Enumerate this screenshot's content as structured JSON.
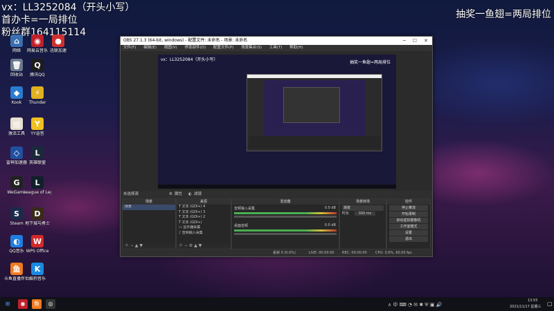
{
  "overlay": {
    "line1": "vx：LL3252084（开头小写）",
    "line2": "首办卡=一局排位",
    "line3": "粉丝群164115114",
    "right": "抽奖一鱼翅=两局排位"
  },
  "desktop_icons": [
    {
      "label": "网络",
      "color": "#3a6fb0",
      "glyph": "⌂"
    },
    {
      "label": "网易云音乐",
      "color": "#c0202a",
      "glyph": "◉"
    },
    {
      "label": "迅联加速",
      "color": "#d13030",
      "glyph": "●"
    },
    {
      "label": "回收站",
      "color": "#6a7a8a",
      "glyph": "🗑"
    },
    {
      "label": "腾讯QQ",
      "color": "#1d1d1d",
      "glyph": "Q"
    },
    {
      "label": "Kook",
      "color": "#2a7bd0",
      "glyph": "◆"
    },
    {
      "label": "Thunder",
      "color": "#e0b020",
      "glyph": "⚡"
    },
    {
      "label": "激活工具",
      "color": "#e8e0d0",
      "glyph": "▤"
    },
    {
      "label": "YY语音",
      "color": "#f0c020",
      "glyph": "Y"
    },
    {
      "label": "雷神加速器",
      "color": "#2050a0",
      "glyph": "◇"
    },
    {
      "label": "英雄联盟",
      "color": "#1a2a3a",
      "glyph": "L"
    },
    {
      "label": "WeGame",
      "color": "#222222",
      "glyph": "G"
    },
    {
      "label": "League of Legends",
      "color": "#10202a",
      "glyph": "L"
    },
    {
      "label": "Steam",
      "color": "#1a2a4a",
      "glyph": "S"
    },
    {
      "label": "地下城与勇士",
      "color": "#3a2a1a",
      "glyph": "D"
    },
    {
      "label": "QQ音乐",
      "color": "#1f7de0",
      "glyph": "◐"
    },
    {
      "label": "WPS Office",
      "color": "#d02a2a",
      "glyph": "W"
    },
    {
      "label": "斗鱼直播伴侣",
      "color": "#f07a20",
      "glyph": "鱼"
    },
    {
      "label": "酷狗音乐",
      "color": "#1a8ae0",
      "glyph": "K"
    }
  ],
  "obs": {
    "title": "OBS 27.1.3 (64-bit, windows) - 配置文件: 未命名 - 场景: 未命名",
    "menu": [
      "文件(F)",
      "编辑(E)",
      "视图(V)",
      "停靠部件(D)",
      "配置文件(P)",
      "场景集合(S)",
      "工具(T)",
      "帮助(H)"
    ],
    "preview_overlay_left": "vx：LL3252084（开头小写）",
    "preview_overlay_right": "抽奖一鱼翅=两局排位",
    "toolbar_label": "未选择源",
    "toolbar_props": "属性",
    "toolbar_filters": "滤镜",
    "docks": {
      "scenes": {
        "title": "场景",
        "items": [
          "场景"
        ]
      },
      "sources": {
        "title": "来源",
        "items": [
          "文本 (GDI+) 4",
          "文本 (GDI+) 3",
          "文本 (GDI+) 2",
          "文本 (GDI+)",
          "显示器采集",
          "音频输入采集"
        ]
      },
      "mixer": {
        "title": "混音器",
        "channels": [
          {
            "name": "音频输入采集",
            "db": "0.0 dB"
          },
          {
            "name": "桌面音频",
            "db": "0.0 dB"
          }
        ]
      },
      "transitions": {
        "title": "场景转场",
        "type": "渐变",
        "duration_label": "时长",
        "duration": "300 ms"
      },
      "controls": {
        "title": "控件",
        "buttons": [
          "停止推流",
          "开始录制",
          "启动虚拟摄像机",
          "工作室模式",
          "设置",
          "退出"
        ]
      }
    },
    "status": {
      "dropped": "丢帧 0 (0.0%)",
      "live": "LIVE: 00:00:00",
      "rec": "REC: 00:00:00",
      "cpu": "CPU: 3.6%, 60.00 fps"
    }
  },
  "taskbar": {
    "time": "13:55",
    "date": "2021/11/17 星期三"
  }
}
